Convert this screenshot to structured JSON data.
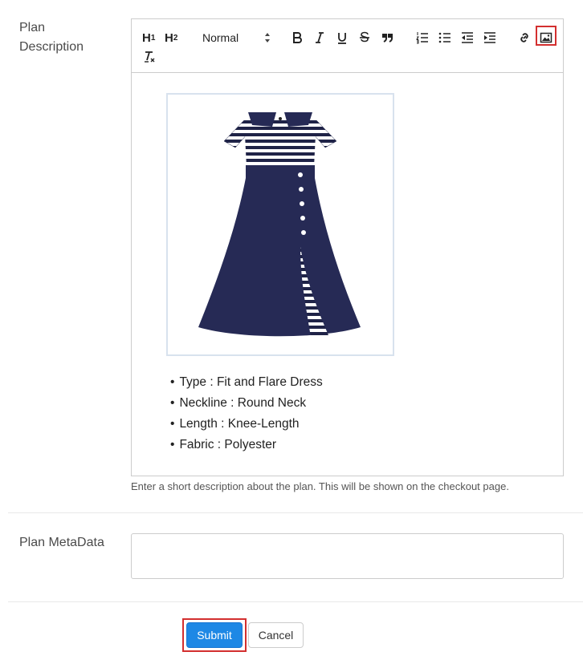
{
  "labels": {
    "plan_description_line1": "Plan",
    "plan_description_line2": "Description",
    "plan_metadata": "Plan MetaData"
  },
  "toolbar": {
    "h1": "H",
    "h1_sub": "1",
    "h2": "H",
    "h2_sub": "2",
    "format_select": "Normal"
  },
  "editor": {
    "features": [
      "Type : Fit and Flare Dress",
      "Neckline : Round Neck",
      "Length : Knee-Length",
      "Fabric : Polyester"
    ]
  },
  "hint": "Enter a short description about the plan. This will be shown on the checkout page.",
  "metadata": {
    "value": ""
  },
  "actions": {
    "submit": "Submit",
    "cancel": "Cancel"
  },
  "colors": {
    "primary": "#1e88e5",
    "highlight": "#d32f2f",
    "dress_navy": "#262a55"
  }
}
